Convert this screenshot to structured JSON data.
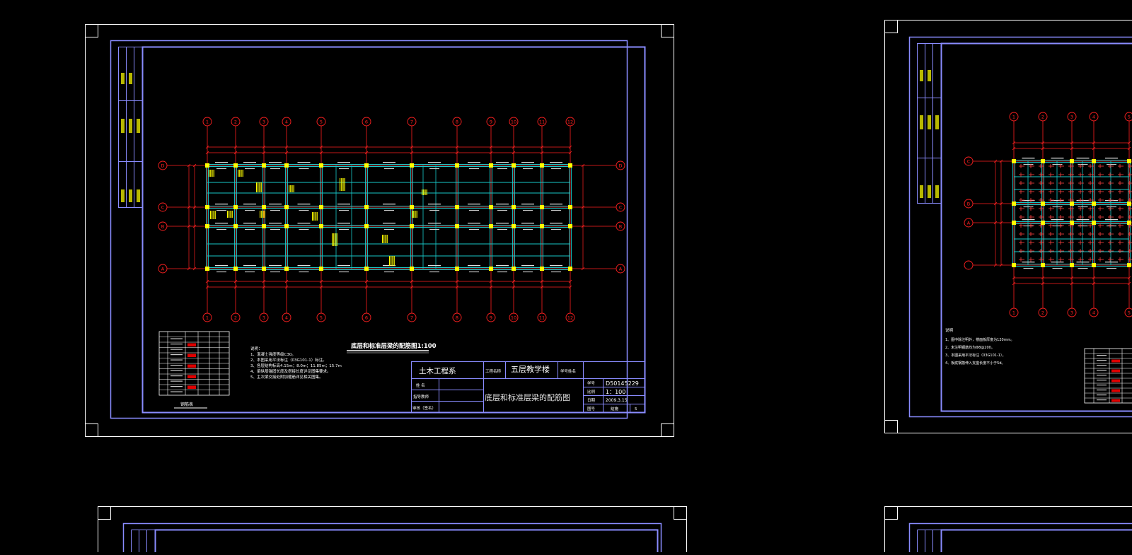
{
  "colors": {
    "background": "#000000",
    "frame": "#ffffff",
    "border": "#8a8cff",
    "axis": "#ff2020",
    "beam": "#18c8c8",
    "column": "#ffff00",
    "text": "#ffffff"
  },
  "sheet1": {
    "axis_labels_x": [
      "1",
      "2",
      "3",
      "4",
      "5",
      "6",
      "7",
      "8",
      "9",
      "10",
      "11",
      "12"
    ],
    "axis_labels_y": [
      "D",
      "C",
      "B",
      "A"
    ],
    "drawing_title": "底层和标准层梁的配筋图1:100",
    "notes": {
      "heading": "说明：",
      "lines": [
        "1、混凝土强度等级C30。",
        "2、本图采用平法标注（03G101-1）标注。",
        "3、各层结构标高4.15m；8.0m；11.85m；15.7m",
        "4、梁纵筋锚固长度及搭接长度详见图集要求。",
        "5、主次梁交接处附加箍筋详见相关图集。"
      ]
    },
    "table_caption": "钢筋表",
    "title_block": {
      "dept": "土木工程系",
      "project_label": "工程名称",
      "project": "五层教学楼",
      "student_label": "学号姓名",
      "name_label": "姓   名",
      "advisor_label": "指导教师",
      "dean_label": "审核（签名）",
      "sheet_title": "底层和标准层梁的配筋图",
      "code_label": "学号",
      "code": "D50145229",
      "scale_label": "比例",
      "scale": "1：100",
      "date_label": "日期",
      "date": "2009.3.15",
      "sheet_label": "图号",
      "sheet_type": "结施",
      "sheet_no": "5"
    }
  },
  "sheet2": {
    "axis_labels_x": [
      "1",
      "2",
      "3",
      "4",
      "5"
    ],
    "axis_labels_y": [
      "C",
      "B",
      "A"
    ],
    "notes": {
      "heading": "说明",
      "lines": [
        "1、图中除注明外，楼面板厚度为120mm。",
        "2、未注明钢筋均为Φ8@200。",
        "3、本图采用平法标注（03G101-1）。",
        "4、板底钢筋伸入支座长度不小于5d。"
      ]
    }
  }
}
